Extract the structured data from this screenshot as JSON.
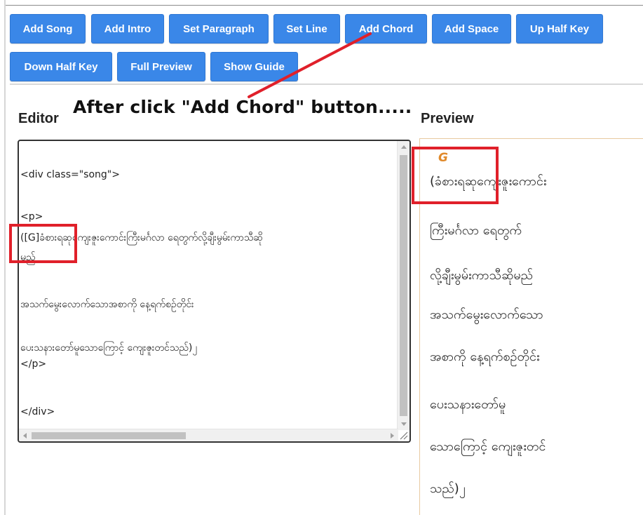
{
  "toolbar": {
    "buttons": [
      "Add Song",
      "Add Intro",
      "Set Paragraph",
      "Set Line",
      "Add Chord",
      "Add Space",
      "Up Half Key",
      "Down Half Key",
      "Full Preview",
      "Show Guide"
    ]
  },
  "annotation": {
    "caption": "After click \"Add Chord\" button....."
  },
  "editor": {
    "label": "Editor",
    "lines": [
      "<div class=\"song\">",
      "<p>",
      "([G]ခံစားရဆုကျေးဇူးကောင်းကြီးမင်္ဂလာ ရေတွက်လို့ချီးမွမ်းကာသီဆို",
      "မည်",
      "အသက်မွေးလောက်သောအစာကို နေ့ရက်စဉ်တိုင်း",
      " ပေးသနားတော်မူသောကြောင့် ကျေးဇူးတင်သည်)၂",
      "</p>",
      "</div>"
    ]
  },
  "preview": {
    "label": "Preview",
    "chord": "G",
    "lines": [
      "(ခံစားရဆုကျေးဇူးကောင်း",
      "ကြီးမင်္ဂလာ ရေတွက်",
      "လို့ချီးမွမ်းကာသီဆိုမည်",
      "အသက်မွေးလောက်သော",
      "အစာကို နေ့ရက်စဉ်တိုင်း",
      "ပေးသနားတော်မူ",
      "သောကြောင့် ကျေးဇူးတင်",
      "သည်)၂"
    ]
  },
  "colors": {
    "button_bg": "#3a87e8",
    "button_text": "#ffffff",
    "highlight": "#e0202a",
    "chord": "#e08a2c",
    "preview_border": "#e8c9a0"
  }
}
